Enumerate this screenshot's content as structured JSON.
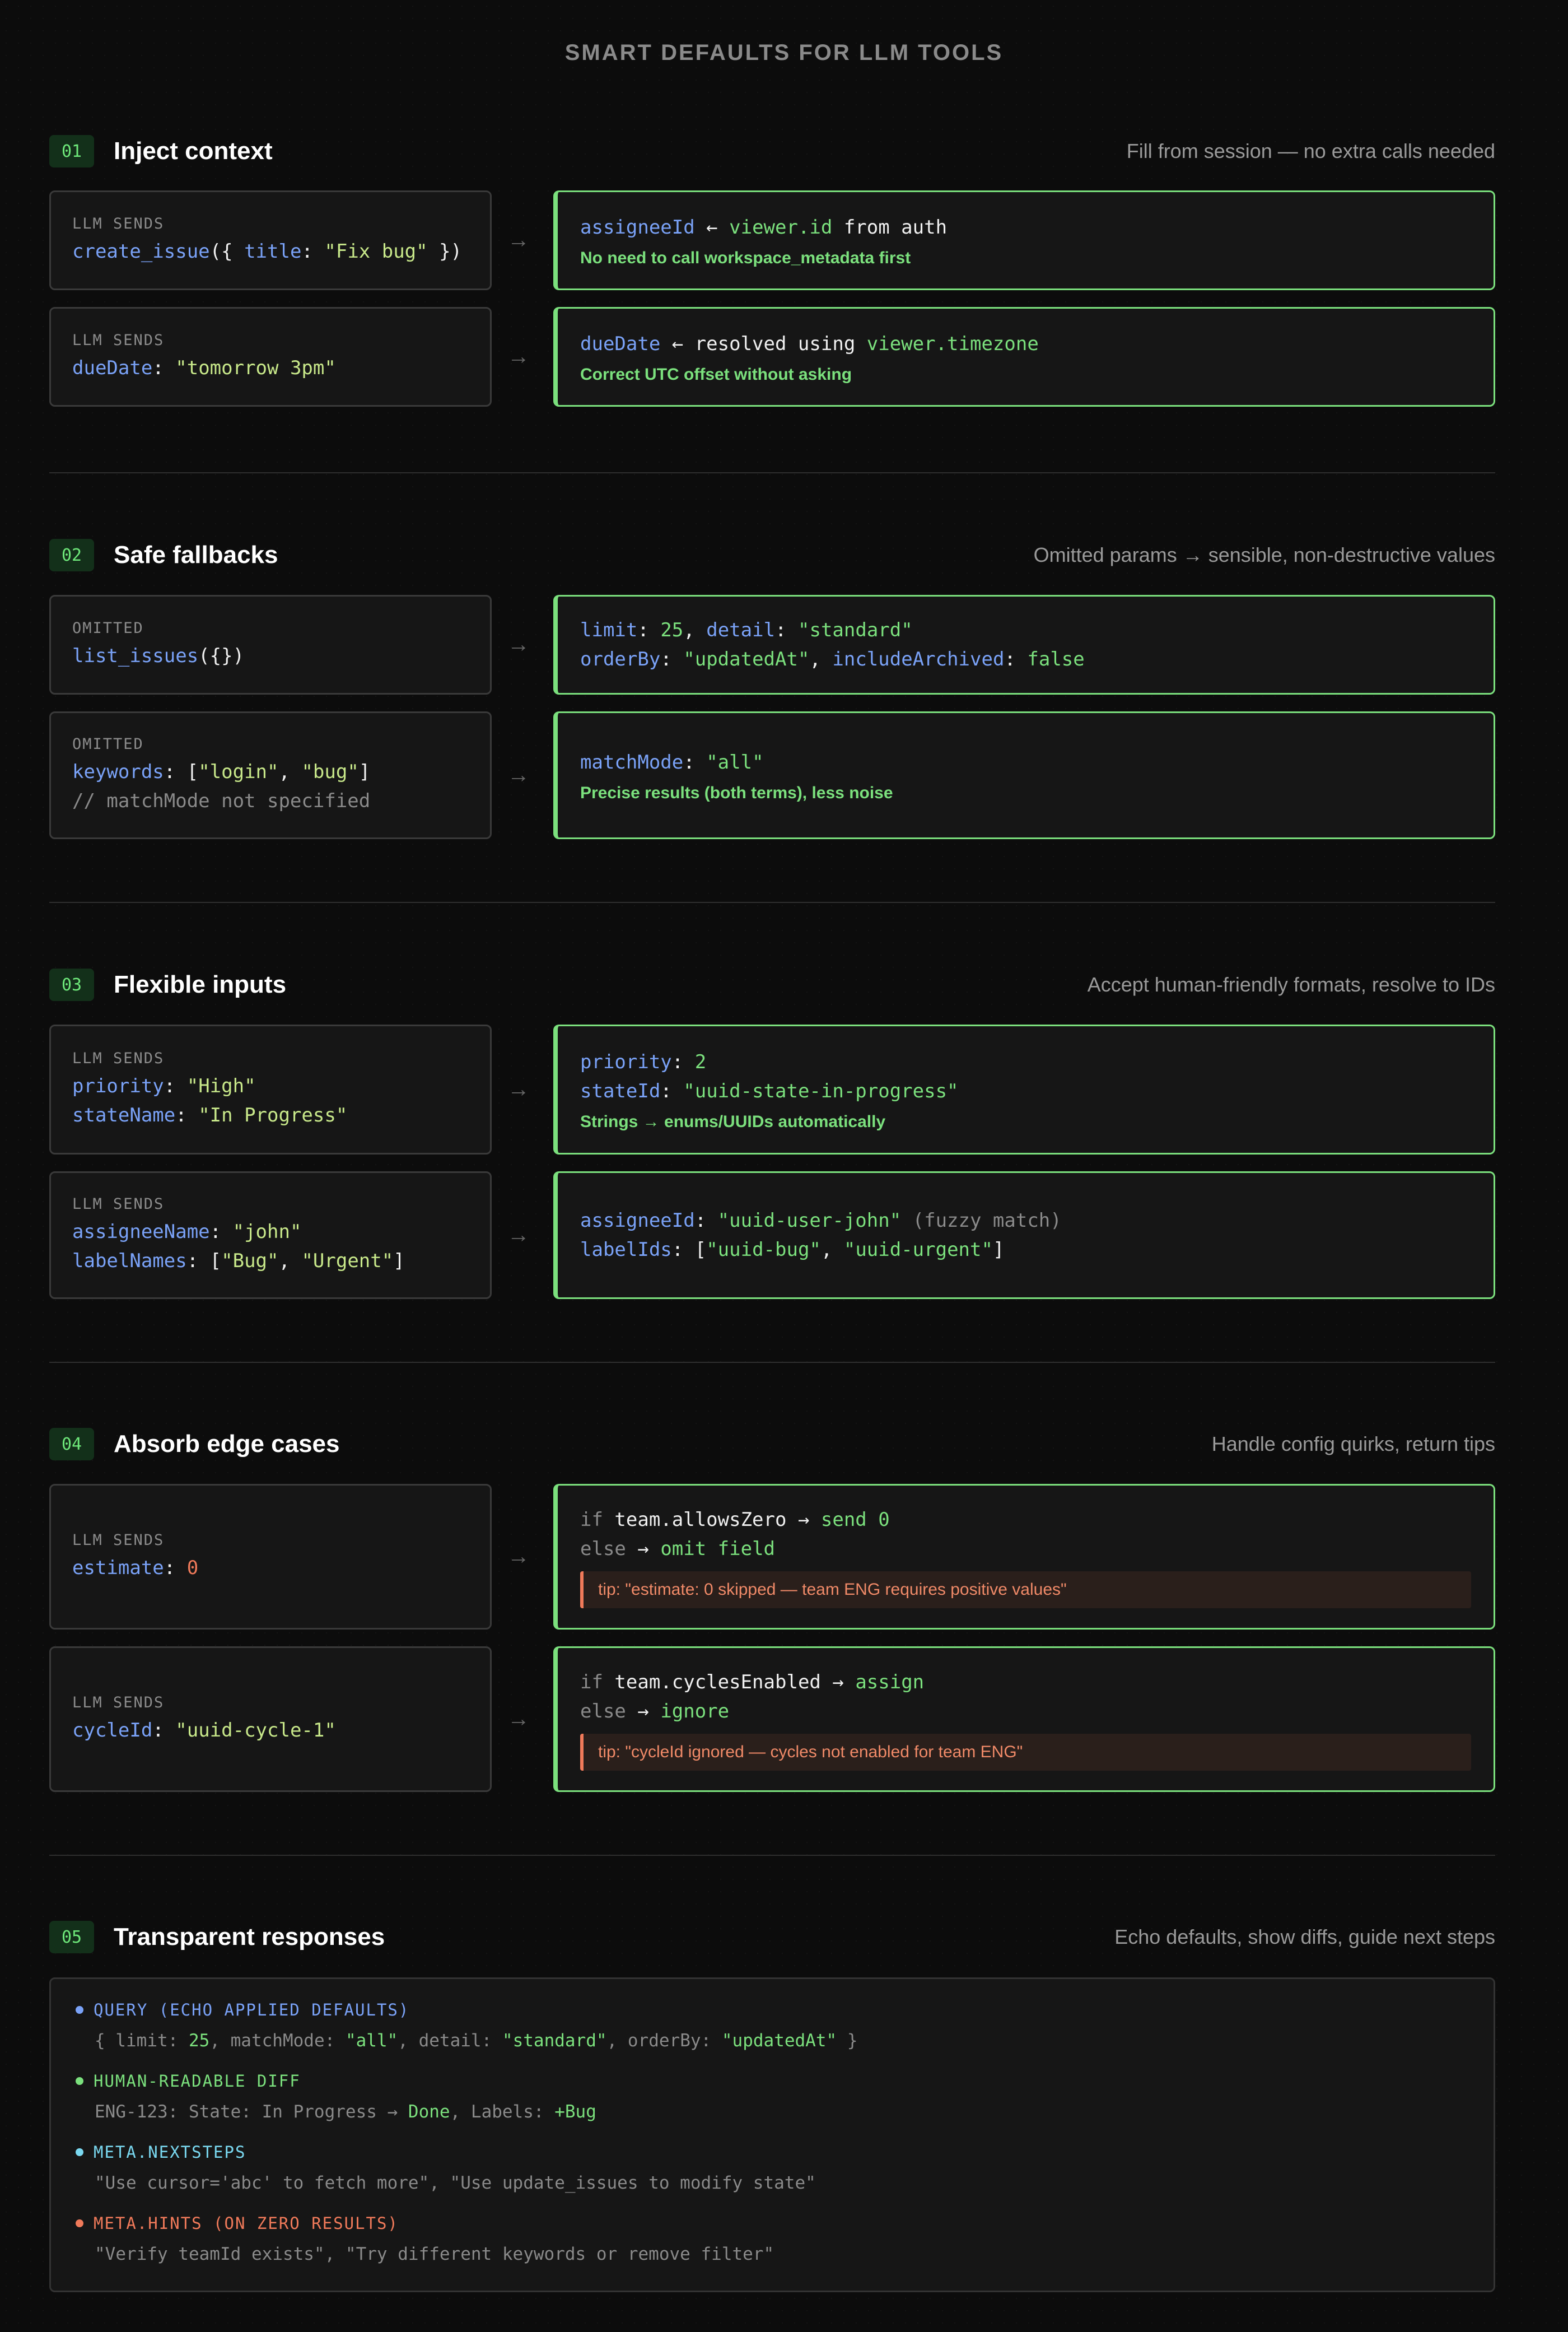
{
  "title": "SMART DEFAULTS FOR LLM TOOLS",
  "sections": [
    {
      "num": "01",
      "title": "Inject context",
      "subtitle": "Fill from session — no extra calls needed",
      "rows": [
        {
          "tag": "LLM SENDS",
          "left": [
            [
              "create_issue",
              "k"
            ],
            [
              "({ ",
              "w"
            ],
            [
              "title",
              "k"
            ],
            [
              ": ",
              "w"
            ],
            [
              "\"Fix bug\"",
              "s"
            ],
            [
              " })",
              "w"
            ]
          ],
          "right_lines": [
            [
              [
                "assigneeId",
                "k"
              ],
              [
                " ← ",
                "w"
              ],
              [
                "viewer.id",
                "g"
              ],
              [
                " from auth",
                "w"
              ]
            ]
          ],
          "note": "No need to call workspace_metadata first"
        },
        {
          "tag": "LLM SENDS",
          "left": [
            [
              "dueDate",
              "k"
            ],
            [
              ": ",
              "w"
            ],
            [
              "\"tomorrow 3pm\"",
              "s"
            ]
          ],
          "right_lines": [
            [
              [
                "dueDate",
                "k"
              ],
              [
                " ← resolved using ",
                "w"
              ],
              [
                "viewer.timezone",
                "g"
              ]
            ]
          ],
          "note": "Correct UTC offset without asking"
        }
      ]
    },
    {
      "num": "02",
      "title": "Safe fallbacks",
      "subtitle": "Omitted params → sensible, non-destructive values",
      "rows": [
        {
          "tag": "OMITTED",
          "left": [
            [
              "list_issues",
              "k"
            ],
            [
              "({})",
              "w"
            ]
          ],
          "right_lines": [
            [
              [
                "limit",
                "k"
              ],
              [
                ": ",
                "w"
              ],
              [
                "25",
                "n"
              ],
              [
                ", ",
                "w"
              ],
              [
                "detail",
                "k"
              ],
              [
                ": ",
                "w"
              ],
              [
                "\"standard\"",
                "g"
              ]
            ],
            [
              [
                "orderBy",
                "k"
              ],
              [
                ": ",
                "w"
              ],
              [
                "\"updatedAt\"",
                "g"
              ],
              [
                ", ",
                "w"
              ],
              [
                "includeArchived",
                "k"
              ],
              [
                ": ",
                "w"
              ],
              [
                "false",
                "g"
              ]
            ]
          ]
        },
        {
          "tag": "OMITTED",
          "left": [
            [
              "keywords",
              "k"
            ],
            [
              ": [",
              "w"
            ],
            [
              "\"login\"",
              "s"
            ],
            [
              ", ",
              "w"
            ],
            [
              "\"bug\"",
              "s"
            ],
            [
              "]",
              "w"
            ]
          ],
          "left2": "// matchMode not specified",
          "right_lines": [
            [
              [
                "matchMode",
                "k"
              ],
              [
                ": ",
                "w"
              ],
              [
                "\"all\"",
                "g"
              ]
            ]
          ],
          "note": "Precise results (both terms), less noise"
        }
      ]
    },
    {
      "num": "03",
      "title": "Flexible inputs",
      "subtitle": "Accept human-friendly formats, resolve to IDs",
      "rows": [
        {
          "tag": "LLM SENDS",
          "left": [
            [
              "priority",
              "k"
            ],
            [
              ": ",
              "w"
            ],
            [
              "\"High\"",
              "s"
            ]
          ],
          "left2_tokens": [
            [
              "stateName",
              "k"
            ],
            [
              ": ",
              "w"
            ],
            [
              "\"In Progress\"",
              "s"
            ]
          ],
          "right_lines": [
            [
              [
                "priority",
                "k"
              ],
              [
                ": ",
                "w"
              ],
              [
                "2",
                "n"
              ]
            ],
            [
              [
                "stateId",
                "k"
              ],
              [
                ": ",
                "w"
              ],
              [
                "\"uuid-state-in-progress\"",
                "g"
              ]
            ]
          ],
          "note": "Strings → enums/UUIDs automatically"
        },
        {
          "tag": "LLM SENDS",
          "left": [
            [
              "assigneeName",
              "k"
            ],
            [
              ": ",
              "w"
            ],
            [
              "\"john\"",
              "s"
            ]
          ],
          "left2_tokens": [
            [
              "labelNames",
              "k"
            ],
            [
              ": [",
              "w"
            ],
            [
              "\"Bug\"",
              "s"
            ],
            [
              ", ",
              "w"
            ],
            [
              "\"Urgent\"",
              "s"
            ],
            [
              "]",
              "w"
            ]
          ],
          "right_lines": [
            [
              [
                "assigneeId",
                "k"
              ],
              [
                ": ",
                "w"
              ],
              [
                "\"uuid-user-john\"",
                "g"
              ],
              [
                " (fuzzy match)",
                "c"
              ]
            ],
            [
              [
                "labelIds",
                "k"
              ],
              [
                ": [",
                "w"
              ],
              [
                "\"uuid-bug\"",
                "g"
              ],
              [
                ", ",
                "w"
              ],
              [
                "\"uuid-urgent\"",
                "g"
              ],
              [
                "]",
                "w"
              ]
            ]
          ]
        }
      ]
    },
    {
      "num": "04",
      "title": "Absorb edge cases",
      "subtitle": "Handle config quirks, return tips",
      "rows": [
        {
          "tag": "LLM SENDS",
          "left": [
            [
              "estimate",
              "k"
            ],
            [
              ": ",
              "w"
            ],
            [
              "0",
              "r"
            ]
          ],
          "right_lines": [
            [
              [
                "if ",
                "kw"
              ],
              [
                "team.allowsZero",
                "w"
              ],
              [
                " → ",
                "w"
              ],
              [
                "send 0",
                "g"
              ]
            ],
            [
              [
                "else",
                "kw"
              ],
              [
                " → ",
                "w"
              ],
              [
                "omit field",
                "g"
              ]
            ]
          ],
          "tip": "tip: \"estimate: 0 skipped — team ENG requires positive values\""
        },
        {
          "tag": "LLM SENDS",
          "left": [
            [
              "cycleId",
              "k"
            ],
            [
              ": ",
              "w"
            ],
            [
              "\"uuid-cycle-1\"",
              "s"
            ]
          ],
          "right_lines": [
            [
              [
                "if ",
                "kw"
              ],
              [
                "team.cyclesEnabled",
                "w"
              ],
              [
                " → ",
                "w"
              ],
              [
                "assign",
                "g"
              ]
            ],
            [
              [
                "else",
                "kw"
              ],
              [
                " → ",
                "w"
              ],
              [
                "ignore",
                "g"
              ]
            ]
          ],
          "tip": "tip: \"cycleId ignored — cycles not enabled for team ENG\""
        }
      ]
    },
    {
      "num": "05",
      "title": "Transparent responses",
      "subtitle": "Echo defaults, show diffs, guide next steps"
    }
  ],
  "responses": [
    {
      "label": "QUERY (ECHO APPLIED DEFAULTS)",
      "color": "#7aa2f7",
      "body": [
        [
          "{ limit: ",
          "c"
        ],
        [
          "25",
          "g"
        ],
        [
          ", matchMode: ",
          "c"
        ],
        [
          "\"all\"",
          "g"
        ],
        [
          ", detail: ",
          "c"
        ],
        [
          "\"standard\"",
          "g"
        ],
        [
          ", orderBy: ",
          "c"
        ],
        [
          "\"updatedAt\"",
          "g"
        ],
        [
          " }",
          "c"
        ]
      ]
    },
    {
      "label": "HUMAN-READABLE DIFF",
      "color": "#7be07d",
      "body": [
        [
          "ENG-123: State: In Progress → ",
          "c"
        ],
        [
          "Done",
          "g"
        ],
        [
          ", Labels: ",
          "c"
        ],
        [
          "+Bug",
          "g"
        ]
      ]
    },
    {
      "label": "META.NEXTSTEPS",
      "color": "#7ad8f0",
      "body": [
        [
          "\"Use cursor='abc' to fetch more\", \"Use update_issues to modify state\"",
          "c"
        ]
      ]
    },
    {
      "label": "META.HINTS (ON ZERO RESULTS)",
      "color": "#f07a5a",
      "body": [
        [
          "\"Verify teamId exists\", \"Try different keywords or remove filter\"",
          "c"
        ]
      ]
    }
  ]
}
